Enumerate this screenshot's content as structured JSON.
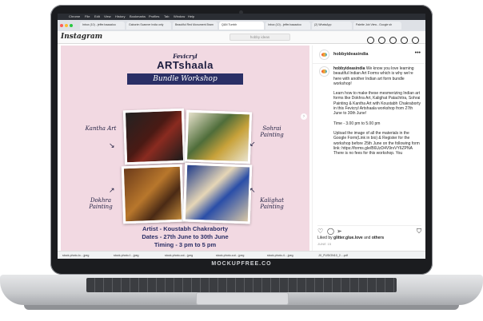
{
  "browser": {
    "menu": [
      "Chrome",
      "File",
      "Edit",
      "View",
      "History",
      "Bookmarks",
      "Profiles",
      "Tab",
      "Window",
      "Help"
    ],
    "tabs": [
      "Inbox (10) - jeffer.baaaaloo",
      "Gaborim Scanner India only",
      "Beautiful Red Monument Bram",
      "Q&N Tumblr",
      "Inbox (10) - jeffer.baaaaloo",
      "(2) WhatsApp",
      "Palette Job View - Google sh"
    ]
  },
  "instagram": {
    "logo": "Instagram",
    "search_placeholder": "hobby ideas"
  },
  "poster": {
    "brand_top": "Fevicryl",
    "brand_main": "ARTshaala",
    "ribbon": "Bundle Workshop",
    "labels": {
      "kantha": "Kantha Art",
      "sohrai": "Sohrai Painting",
      "dokhra": "Dokhra Painting",
      "kalighat": "Kalighat Painting"
    },
    "artist": "Artist - Koustabh Chakraborty",
    "dates": "Dates - 27th June to 30th June",
    "timing": "Timing - 3 pm to 5 pm"
  },
  "post": {
    "account": "hobbyideasindia",
    "caption_intro": "We know you love learning beautiful Indian Art Forms which is why we're here with another Indian art form bundle workshop!",
    "caption_p2": "Learn how to make these mesmerizing Indian art forms like Dokhra Art, Kalighat Patachitra, Sohrai Painting & Kantha Art with Koustabh Chakraborty in this Fevicryl Artshaala workshop from 27th June to 30th June!",
    "caption_p3": "Time - 3.00 pm to 5.00 pm",
    "caption_p4": "Upload the image of all the materials in the Google Form(Link in bio) & Register for the workshop before 25th June on the following form link: https://forms.gle/B6UzD4V9rvVY6ZPNA There is no fees for this workshop. You",
    "likes_prefix": "Liked by",
    "likes_user": "glitter.glue.love",
    "likes_suffix": "and",
    "likes_others": "others",
    "date": "JUNE 15"
  },
  "downloads": [
    "stock-photo-lo....jpeg",
    "stock-photo-f....jpeg",
    "stock-photo-col....jpeg",
    "stock-photo-cut....jpeg",
    "stock-photo-4....jpeg",
    "JX_FUSION10_2....pdf"
  ],
  "watermark": "MOCKUPFREE.CO"
}
